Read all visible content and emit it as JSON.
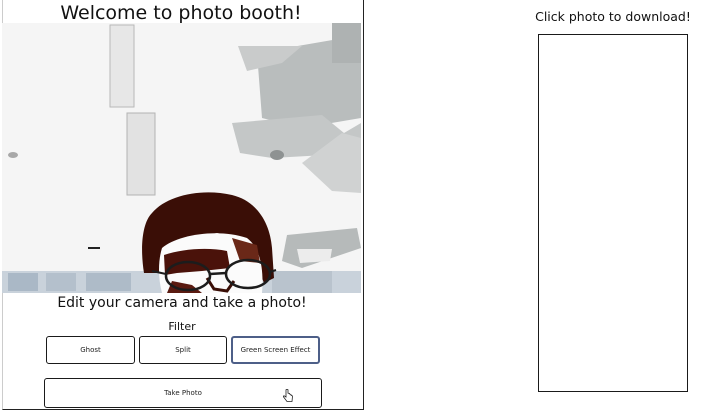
{
  "booth": {
    "title": "Welcome to photo booth!",
    "subtitle": "Edit your camera and take a photo!",
    "filter_label": "Filter",
    "filters": [
      "Ghost",
      "Split",
      "Green Screen Effect"
    ],
    "take_photo_label": "Take Photo"
  },
  "download": {
    "title": "Click photo to download!"
  },
  "colors": {
    "border": "#1a1a1a",
    "focused_border": "#4d5f88"
  }
}
